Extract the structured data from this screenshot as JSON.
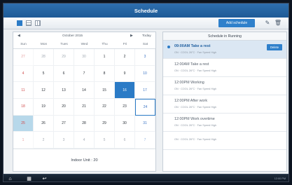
{
  "title": "Schedule",
  "toolbar": {
    "add_label": "Add schedule",
    "views": [
      {
        "name": "day",
        "active": true
      },
      {
        "name": "week",
        "active": false
      },
      {
        "name": "month",
        "active": false
      }
    ]
  },
  "calendar": {
    "prev": "◀",
    "next": "▶",
    "month_label": "October 2015",
    "today_label": "Today",
    "weekdays": [
      "Sun",
      "Mon",
      "Tues",
      "Wed",
      "Thu",
      "Fri",
      "Sat"
    ],
    "weeks": [
      [
        {
          "d": "27",
          "m": 1
        },
        {
          "d": "28",
          "m": 1
        },
        {
          "d": "29",
          "m": 1
        },
        {
          "d": "30",
          "m": 1
        },
        {
          "d": "1"
        },
        {
          "d": "2"
        },
        {
          "d": "3"
        }
      ],
      [
        {
          "d": "4"
        },
        {
          "d": "5"
        },
        {
          "d": "6"
        },
        {
          "d": "7"
        },
        {
          "d": "8"
        },
        {
          "d": "9"
        },
        {
          "d": "10"
        }
      ],
      [
        {
          "d": "11"
        },
        {
          "d": "12"
        },
        {
          "d": "13"
        },
        {
          "d": "14"
        },
        {
          "d": "15"
        },
        {
          "d": "16",
          "sel": 1
        },
        {
          "d": "17"
        }
      ],
      [
        {
          "d": "18"
        },
        {
          "d": "19"
        },
        {
          "d": "20"
        },
        {
          "d": "21"
        },
        {
          "d": "22"
        },
        {
          "d": "23"
        },
        {
          "d": "24",
          "today": 1
        }
      ],
      [
        {
          "d": "25",
          "shade": 1
        },
        {
          "d": "26"
        },
        {
          "d": "27"
        },
        {
          "d": "28"
        },
        {
          "d": "29"
        },
        {
          "d": "30"
        },
        {
          "d": "31"
        }
      ],
      [
        {
          "d": "1",
          "m": 1
        },
        {
          "d": "2",
          "m": 1
        },
        {
          "d": "3",
          "m": 1
        },
        {
          "d": "4",
          "m": 1
        },
        {
          "d": "5",
          "m": 1
        },
        {
          "d": "6",
          "m": 1
        },
        {
          "d": "7",
          "m": 1
        }
      ]
    ],
    "footer": "Indoor Unit : 20"
  },
  "list": {
    "header": "Schedule in Running",
    "delete_label": "Delete",
    "items": [
      {
        "time": "09:00AM Take a rest",
        "meta": "ON  ·  COOL 26°C  ·  Fan Speed High",
        "running": true
      },
      {
        "time": "12:00AM Take a rest",
        "meta": "ON  ·  COOL 26°C  ·  Fan Speed High"
      },
      {
        "time": "12:00PM Working",
        "meta": "ON  ·  COOL 26°C  ·  Fan Speed High"
      },
      {
        "time": "12:00PM After work",
        "meta": "ON  ·  COOL 26°C  ·  Fan Speed High"
      },
      {
        "time": "12:00PM Work overtime",
        "meta": "ON  ·  COOL 26°C  ·  Fan Speed High"
      },
      {
        "time": "",
        "meta": "ON  ·  COOL 26°C  ·  Fan Speed High"
      }
    ]
  },
  "taskbar": {
    "clock": "12:00 PM"
  }
}
